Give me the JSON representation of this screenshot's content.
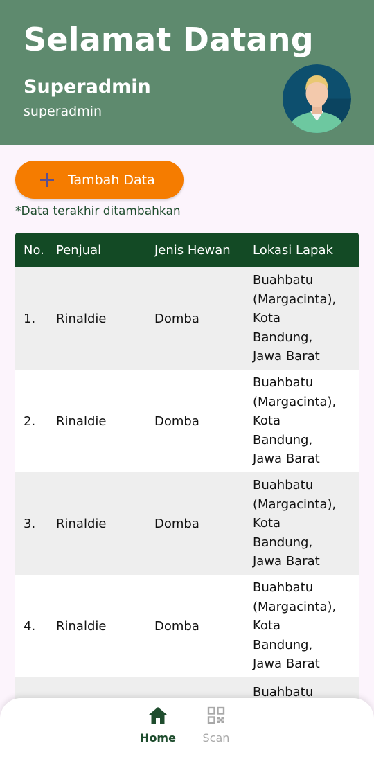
{
  "header": {
    "greeting": "Selamat Datang",
    "user_name": "Superadmin",
    "user_login": "superadmin",
    "avatar_icon": "user-avatar-icon"
  },
  "actions": {
    "add_label": "Tambah Data",
    "add_icon": "plus-icon"
  },
  "note": "*Data terakhir ditambahkan",
  "table": {
    "columns": [
      "No.",
      "Penjual",
      "Jenis Hewan",
      "Lokasi Lapak"
    ],
    "rows": [
      {
        "no": "1.",
        "penjual": "Rinaldie",
        "jenis": "Domba",
        "lokasi": [
          "Buahbatu",
          "(Margacinta),",
          "Kota",
          "Bandung,",
          "Jawa Barat"
        ]
      },
      {
        "no": "2.",
        "penjual": "Rinaldie",
        "jenis": "Domba",
        "lokasi": [
          "Buahbatu",
          "(Margacinta),",
          "Kota",
          "Bandung,",
          "Jawa Barat"
        ]
      },
      {
        "no": "3.",
        "penjual": "Rinaldie",
        "jenis": "Domba",
        "lokasi": [
          "Buahbatu",
          "(Margacinta),",
          "Kota",
          "Bandung,",
          "Jawa Barat"
        ]
      },
      {
        "no": "4.",
        "penjual": "Rinaldie",
        "jenis": "Domba",
        "lokasi": [
          "Buahbatu",
          "(Margacinta),",
          "Kota",
          "Bandung,",
          "Jawa Barat"
        ]
      }
    ],
    "partial_row_lokasi": "Buahbatu"
  },
  "nav": {
    "home_label": "Home",
    "scan_label": "Scan",
    "home_icon": "home-icon",
    "scan_icon": "qr-code-icon"
  },
  "colors": {
    "header_bg": "#5E8A6E",
    "table_header_bg": "#134A25",
    "button_bg": "#F57C00",
    "page_bg": "#FCF4FC"
  }
}
